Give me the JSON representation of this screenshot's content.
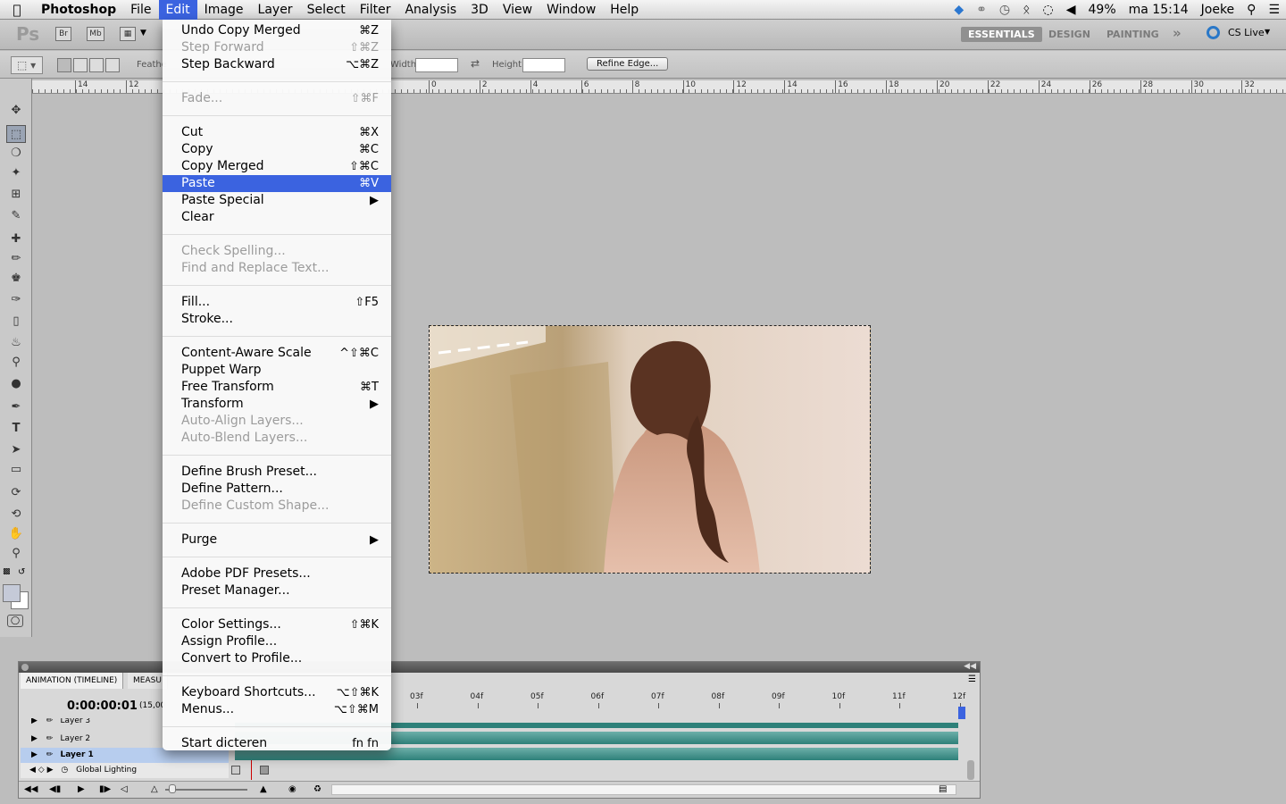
{
  "menubar": {
    "app_name": "Photoshop",
    "items": [
      "File",
      "Edit",
      "Image",
      "Layer",
      "Select",
      "Filter",
      "Analysis",
      "3D",
      "View",
      "Window",
      "Help"
    ],
    "active_item": "Edit",
    "status": {
      "battery": "49%",
      "clock": "ma 15:14",
      "user": "Joeke"
    }
  },
  "appbar": {
    "bridge_label": "Br",
    "minibridge_label": "Mb",
    "workspaces": [
      "ESSENTIALS",
      "DESIGN",
      "PAINTING"
    ],
    "more": "»",
    "cslive": "CS Live"
  },
  "options": {
    "feather_label": "Feathe",
    "width_label": "Width:",
    "height_label": "Height:",
    "refine_edge": "Refine Edge..."
  },
  "ruler": {
    "left_labels": [
      "14",
      "12"
    ],
    "labels": [
      "0",
      "2",
      "4",
      "6",
      "8",
      "10",
      "12",
      "14",
      "16",
      "18",
      "20",
      "22",
      "24",
      "26",
      "28",
      "30",
      "32"
    ]
  },
  "edit_menu": {
    "groups": [
      [
        {
          "label": "Undo Copy Merged",
          "shortcut": "⌘Z",
          "enabled": true
        },
        {
          "label": "Step Forward",
          "shortcut": "⇧⌘Z",
          "enabled": false
        },
        {
          "label": "Step Backward",
          "shortcut": "⌥⌘Z",
          "enabled": true
        }
      ],
      [
        {
          "label": "Fade...",
          "shortcut": "⇧⌘F",
          "enabled": false
        }
      ],
      [
        {
          "label": "Cut",
          "shortcut": "⌘X",
          "enabled": true
        },
        {
          "label": "Copy",
          "shortcut": "⌘C",
          "enabled": true
        },
        {
          "label": "Copy Merged",
          "shortcut": "⇧⌘C",
          "enabled": true
        },
        {
          "label": "Paste",
          "shortcut": "⌘V",
          "enabled": true,
          "highlighted": true
        },
        {
          "label": "Paste Special",
          "shortcut": "▶",
          "enabled": true
        },
        {
          "label": "Clear",
          "shortcut": "",
          "enabled": true
        }
      ],
      [
        {
          "label": "Check Spelling...",
          "shortcut": "",
          "enabled": false
        },
        {
          "label": "Find and Replace Text...",
          "shortcut": "",
          "enabled": false
        }
      ],
      [
        {
          "label": "Fill...",
          "shortcut": "⇧F5",
          "enabled": true
        },
        {
          "label": "Stroke...",
          "shortcut": "",
          "enabled": true
        }
      ],
      [
        {
          "label": "Content-Aware Scale",
          "shortcut": "^⇧⌘C",
          "enabled": true
        },
        {
          "label": "Puppet Warp",
          "shortcut": "",
          "enabled": true
        },
        {
          "label": "Free Transform",
          "shortcut": "⌘T",
          "enabled": true
        },
        {
          "label": "Transform",
          "shortcut": "▶",
          "enabled": true
        },
        {
          "label": "Auto-Align Layers...",
          "shortcut": "",
          "enabled": false
        },
        {
          "label": "Auto-Blend Layers...",
          "shortcut": "",
          "enabled": false
        }
      ],
      [
        {
          "label": "Define Brush Preset...",
          "shortcut": "",
          "enabled": true
        },
        {
          "label": "Define Pattern...",
          "shortcut": "",
          "enabled": true
        },
        {
          "label": "Define Custom Shape...",
          "shortcut": "",
          "enabled": false
        }
      ],
      [
        {
          "label": "Purge",
          "shortcut": "▶",
          "enabled": true
        }
      ],
      [
        {
          "label": "Adobe PDF Presets...",
          "shortcut": "",
          "enabled": true
        },
        {
          "label": "Preset Manager...",
          "shortcut": "",
          "enabled": true
        }
      ],
      [
        {
          "label": "Color Settings...",
          "shortcut": "⇧⌘K",
          "enabled": true
        },
        {
          "label": "Assign Profile...",
          "shortcut": "",
          "enabled": true
        },
        {
          "label": "Convert to Profile...",
          "shortcut": "",
          "enabled": true
        }
      ],
      [
        {
          "label": "Keyboard Shortcuts...",
          "shortcut": "⌥⇧⌘K",
          "enabled": true
        },
        {
          "label": "Menus...",
          "shortcut": "⌥⇧⌘M",
          "enabled": true
        }
      ],
      [
        {
          "label": "Start dicteren",
          "shortcut": "fn fn",
          "enabled": true
        }
      ]
    ]
  },
  "timeline": {
    "tab_animation": "ANIMATION (TIMELINE)",
    "tab_measure": "MEASU",
    "current_time": "0:00:00:01",
    "fps": "(15,00",
    "frames": [
      "03f",
      "04f",
      "05f",
      "06f",
      "07f",
      "08f",
      "09f",
      "10f",
      "11f",
      "12f"
    ],
    "layers": [
      "Layer 3",
      "Layer 2",
      "Layer 1"
    ],
    "global_lighting": "Global Lighting"
  },
  "colors": {
    "highlight": "#3b63e0",
    "track": "#2e8079"
  }
}
